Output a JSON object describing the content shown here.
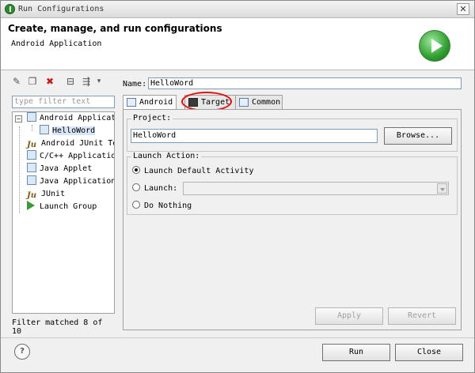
{
  "window": {
    "title": "Run Configurations",
    "close_glyph": "✕"
  },
  "header": {
    "title": "Create, manage, and run configurations",
    "subtitle": "Android Application"
  },
  "left": {
    "filter_placeholder": "type filter text",
    "tree": [
      {
        "label": "Android Applicat",
        "icon": "android-app-icon",
        "expanded_glyph": "−"
      },
      {
        "label": "HelloWord",
        "icon": "android-app-icon",
        "selected": true
      },
      {
        "label": "Android JUnit Te",
        "icon": "junit-icon",
        "glyph": "Ju"
      },
      {
        "label": "C/C++ Applicatio",
        "icon": "c-app-icon"
      },
      {
        "label": "Java Applet",
        "icon": "java-applet-icon"
      },
      {
        "label": "Java Application",
        "icon": "java-app-icon"
      },
      {
        "label": "JUnit",
        "icon": "junit-icon",
        "glyph": "Ju"
      },
      {
        "label": "Launch Group",
        "icon": "launch-group-icon"
      }
    ],
    "status": "Filter matched 8 of 10"
  },
  "right": {
    "name_label": "Name:",
    "name_value": "HelloWord",
    "tabs": [
      {
        "label": "Android",
        "active": true
      },
      {
        "label": "Target"
      },
      {
        "label": "Common"
      }
    ],
    "project": {
      "label": "Project:",
      "value": "HelloWord",
      "browse": "Browse..."
    },
    "launch_action": {
      "label": "Launch Action:",
      "options": [
        {
          "label": "Launch Default Activity",
          "selected": true
        },
        {
          "label": "Launch:"
        },
        {
          "label": "Do Nothing"
        }
      ]
    },
    "apply": "Apply",
    "revert": "Revert"
  },
  "footer": {
    "help_glyph": "?",
    "run": "Run",
    "close": "Close"
  }
}
